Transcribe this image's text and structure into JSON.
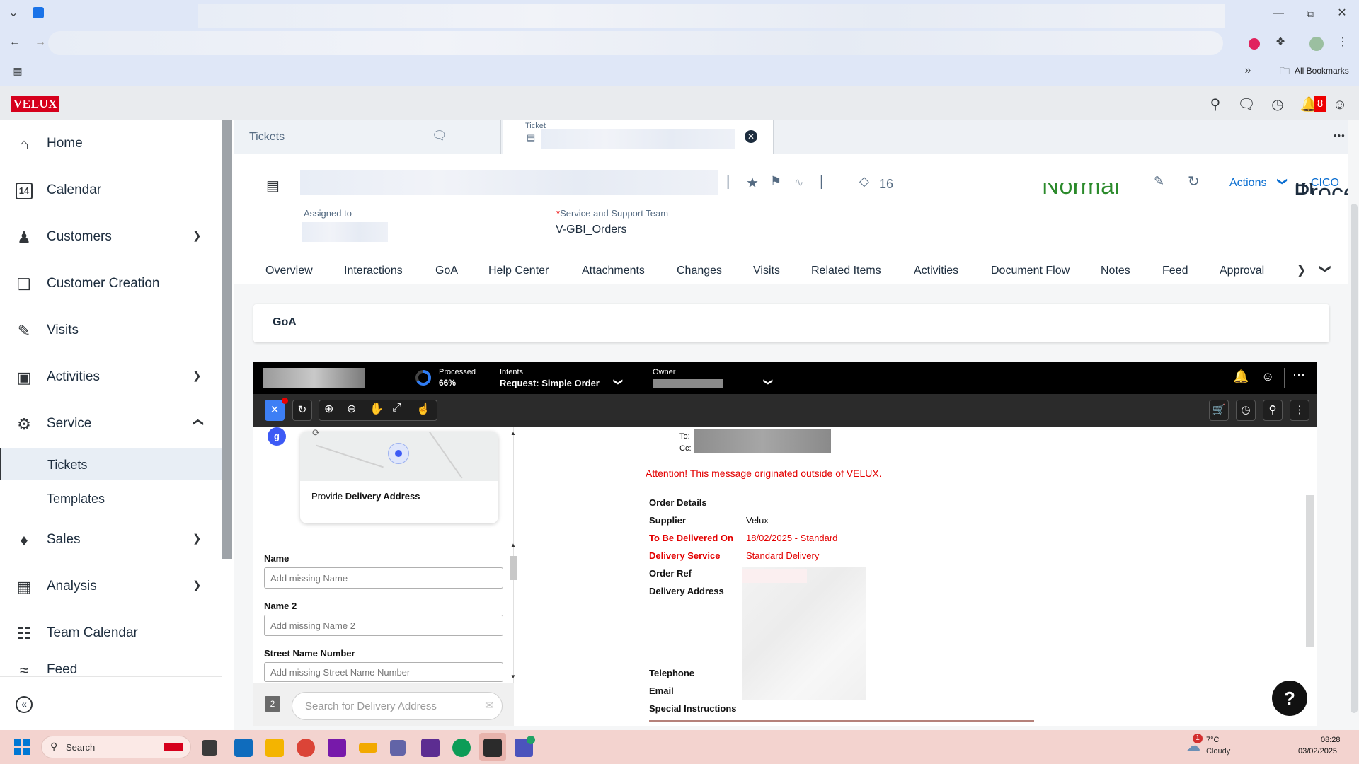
{
  "browser": {
    "bookmarks_label": "All Bookmarks"
  },
  "shell": {
    "logo": "VELUX",
    "notification_count": "8"
  },
  "sidebar": {
    "items": [
      {
        "label": "Home"
      },
      {
        "label": "Calendar"
      },
      {
        "label": "Customers"
      },
      {
        "label": "Customer Creation"
      },
      {
        "label": "Visits"
      },
      {
        "label": "Activities"
      },
      {
        "label": "Service"
      },
      {
        "label": "Sales"
      },
      {
        "label": "Analysis"
      },
      {
        "label": "Team Calendar"
      },
      {
        "label": "Feed"
      }
    ],
    "sub_items": [
      {
        "label": "Tickets"
      },
      {
        "label": "Templates"
      }
    ],
    "calendar_day": "14"
  },
  "tabs": {
    "tickets_label": "Tickets",
    "ticket_caption": "Ticket",
    "more": "•••"
  },
  "header": {
    "count": "16",
    "actions_label": "Actions",
    "cico_label": "CICO",
    "assigned_to_label": "Assigned to",
    "team_required": "*",
    "team_label": "Service and Support Team",
    "team_value": "V-GBI_Orders",
    "partial_status_1": "Normal",
    "partial_status_2": "In Process"
  },
  "subtabs": [
    "Overview",
    "Interactions",
    "GoA",
    "Help Center",
    "Attachments",
    "Changes",
    "Visits",
    "Related Items",
    "Activities",
    "Document Flow",
    "Notes",
    "Feed",
    "Approval"
  ],
  "goa": {
    "title": "GoA"
  },
  "embedded": {
    "processed_label": "Processed",
    "processed_value": "66%",
    "processed_fraction": 0.66,
    "intents_label": "Intents",
    "intents_value": "Request: Simple Order",
    "owner_label": "Owner",
    "step_badge": "2",
    "provide_prefix": "Provide ",
    "provide_bold": "Delivery Address",
    "fields": [
      {
        "label": "Name",
        "placeholder": "Add missing Name"
      },
      {
        "label": "Name 2",
        "placeholder": "Add missing Name 2"
      },
      {
        "label": "Street Name Number",
        "placeholder": "Add missing Street Name Number"
      }
    ],
    "search_placeholder": "Search for Delivery Address",
    "email": {
      "to_label": "To:",
      "cc_label": "Cc:",
      "attention": "Attention! This message originated outside of VELUX.",
      "rows": [
        {
          "label": "Order Details",
          "value": "",
          "red": false
        },
        {
          "label": "Supplier",
          "value": "Velux",
          "red": false
        },
        {
          "label": "To Be Delivered On",
          "value": "18/02/2025 - Standard",
          "red": true
        },
        {
          "label": "Delivery Service",
          "value": "Standard Delivery",
          "red": true
        },
        {
          "label": "Order Ref",
          "value": "",
          "red": false
        },
        {
          "label": "Delivery Address",
          "value": "",
          "red": false
        },
        {
          "label": "Telephone",
          "value": "",
          "red": false
        },
        {
          "label": "Email",
          "value": "",
          "red": false
        },
        {
          "label": "Special Instructions",
          "value": "",
          "red": false
        }
      ]
    }
  },
  "help_button": "?",
  "taskbar": {
    "search_label": "Search",
    "weather_temp": "7°C",
    "weather_desc": "Cloudy",
    "weather_alert": "1",
    "time": "08:28",
    "date": "03/02/2025"
  }
}
